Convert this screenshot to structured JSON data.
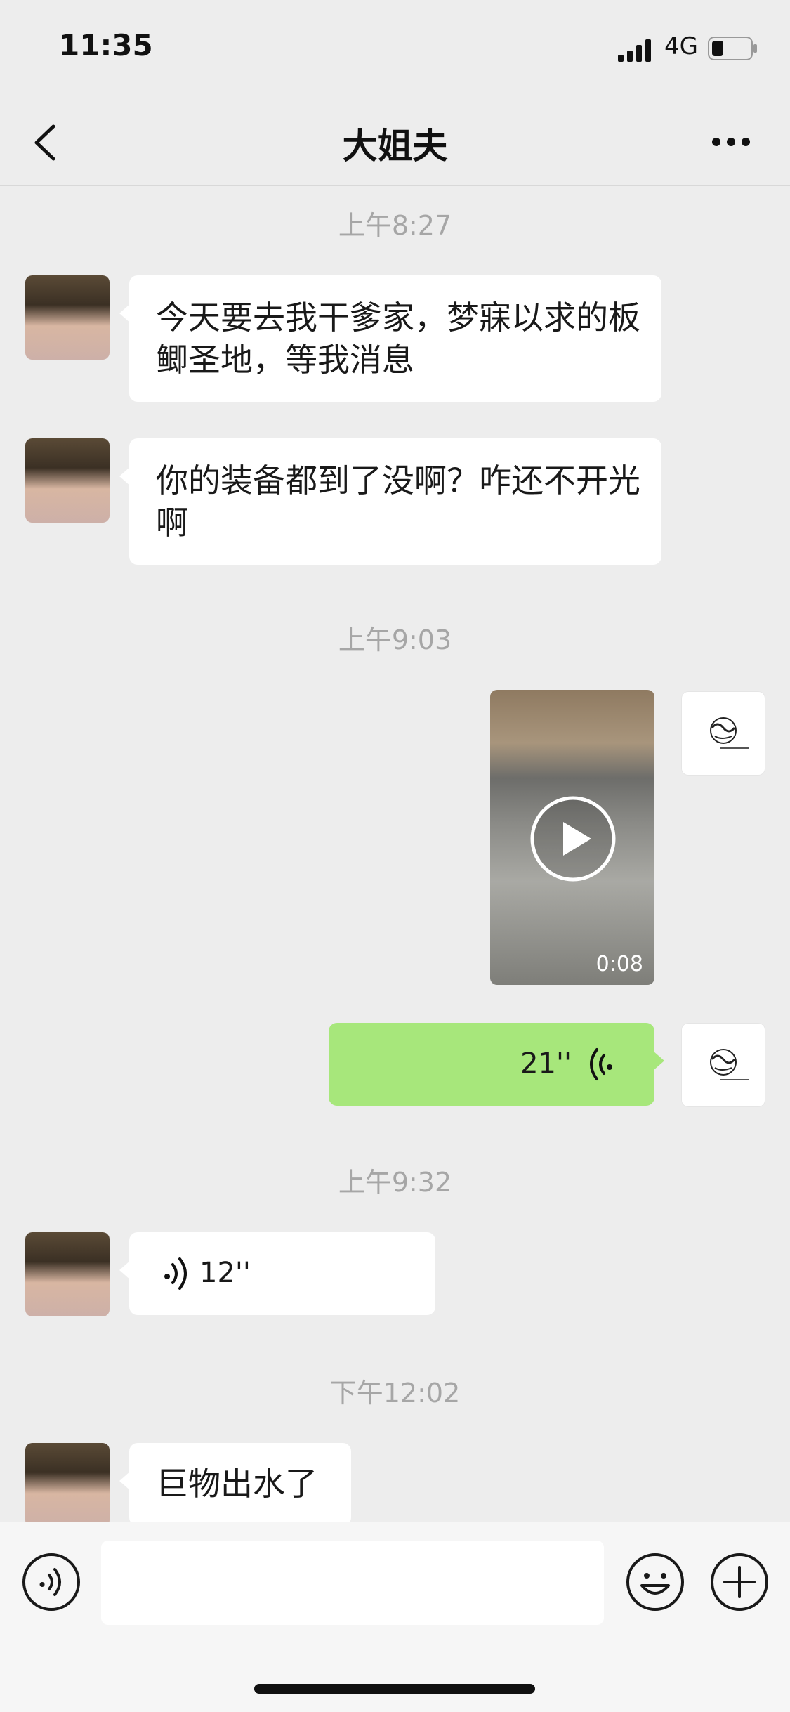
{
  "status": {
    "time": "11:35",
    "network": "4G"
  },
  "nav": {
    "title": "大姐夫"
  },
  "timestamps": [
    "上午8:27",
    "上午9:03",
    "上午9:32",
    "下午12:02"
  ],
  "messages": [
    {
      "from": "other",
      "type": "text",
      "text": "今天要去我干爹家，梦寐以求的板鲫圣地，等我消息"
    },
    {
      "from": "other",
      "type": "text",
      "text": "你的装备都到了没啊？咋还不开光啊"
    },
    {
      "from": "self",
      "type": "video",
      "duration": "0:08"
    },
    {
      "from": "self",
      "type": "voice",
      "duration": "21''"
    },
    {
      "from": "other",
      "type": "voice",
      "duration": "12''"
    },
    {
      "from": "other",
      "type": "text",
      "text": "巨物出水了"
    }
  ],
  "icons": {
    "back": "chevron-left-icon",
    "more": "more-dots-icon",
    "voice_input": "voice-icon",
    "emoji": "emoji-icon",
    "plus": "plus-circle-icon",
    "play": "play-icon"
  },
  "colors": {
    "outgoing_bubble": "#a7e77b",
    "incoming_bubble": "#ffffff",
    "background": "#ededed"
  }
}
